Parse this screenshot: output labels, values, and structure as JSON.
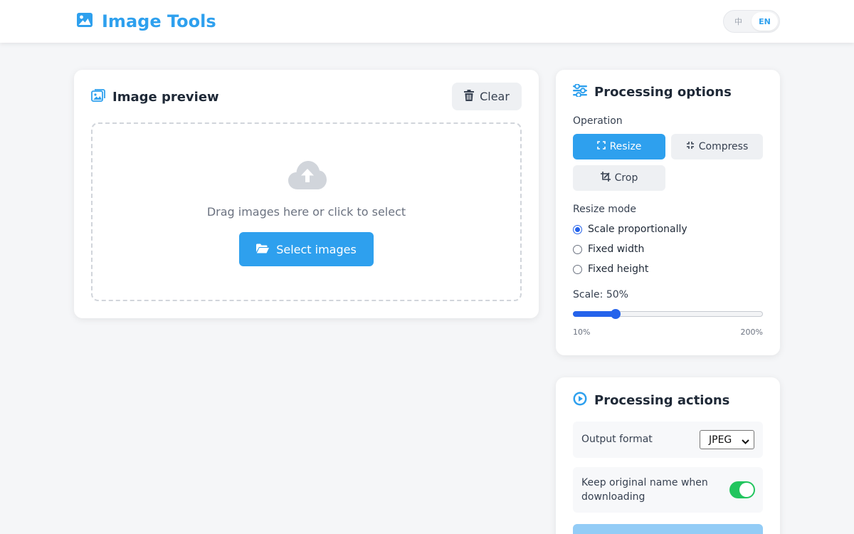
{
  "header": {
    "title": "Image Tools",
    "icon": "image-icon",
    "languages": [
      {
        "label": "中",
        "active": false
      },
      {
        "label": "EN",
        "active": true
      }
    ]
  },
  "preview": {
    "title": "Image preview",
    "title_icon": "images-icon",
    "clear_label": "Clear",
    "clear_icon": "trash-icon",
    "drop_icon": "cloud-upload-icon",
    "drop_text": "Drag images here or click to select",
    "select_label": "Select images",
    "select_icon": "folder-open-icon"
  },
  "options": {
    "title": "Processing options",
    "title_icon": "sliders-icon",
    "operation_label": "Operation",
    "operations": [
      {
        "label": "Resize",
        "icon": "expand-icon",
        "active": true
      },
      {
        "label": "Compress",
        "icon": "compress-icon",
        "active": false
      },
      {
        "label": "Crop",
        "icon": "crop-icon",
        "active": false
      }
    ],
    "resize_mode_label": "Resize mode",
    "resize_modes": [
      {
        "label": "Scale proportionally",
        "checked": true
      },
      {
        "label": "Fixed width",
        "checked": false
      },
      {
        "label": "Fixed height",
        "checked": false
      }
    ],
    "scale_label": "Scale: 50%",
    "scale": {
      "value": 50,
      "min": 10,
      "max": 200
    },
    "scale_min_label": "10%",
    "scale_max_label": "200%"
  },
  "actions": {
    "title": "Processing actions",
    "title_icon": "play-circle-icon",
    "output_format_label": "Output format",
    "output_format_value": "JPEG",
    "keep_name_label": "Keep original name when downloading",
    "keep_name_enabled": true
  },
  "colors": {
    "accent": "#2ea0ee",
    "slider": "#2563eb",
    "toggle_on": "#22c55e",
    "button_bg": "#eef0f3"
  }
}
